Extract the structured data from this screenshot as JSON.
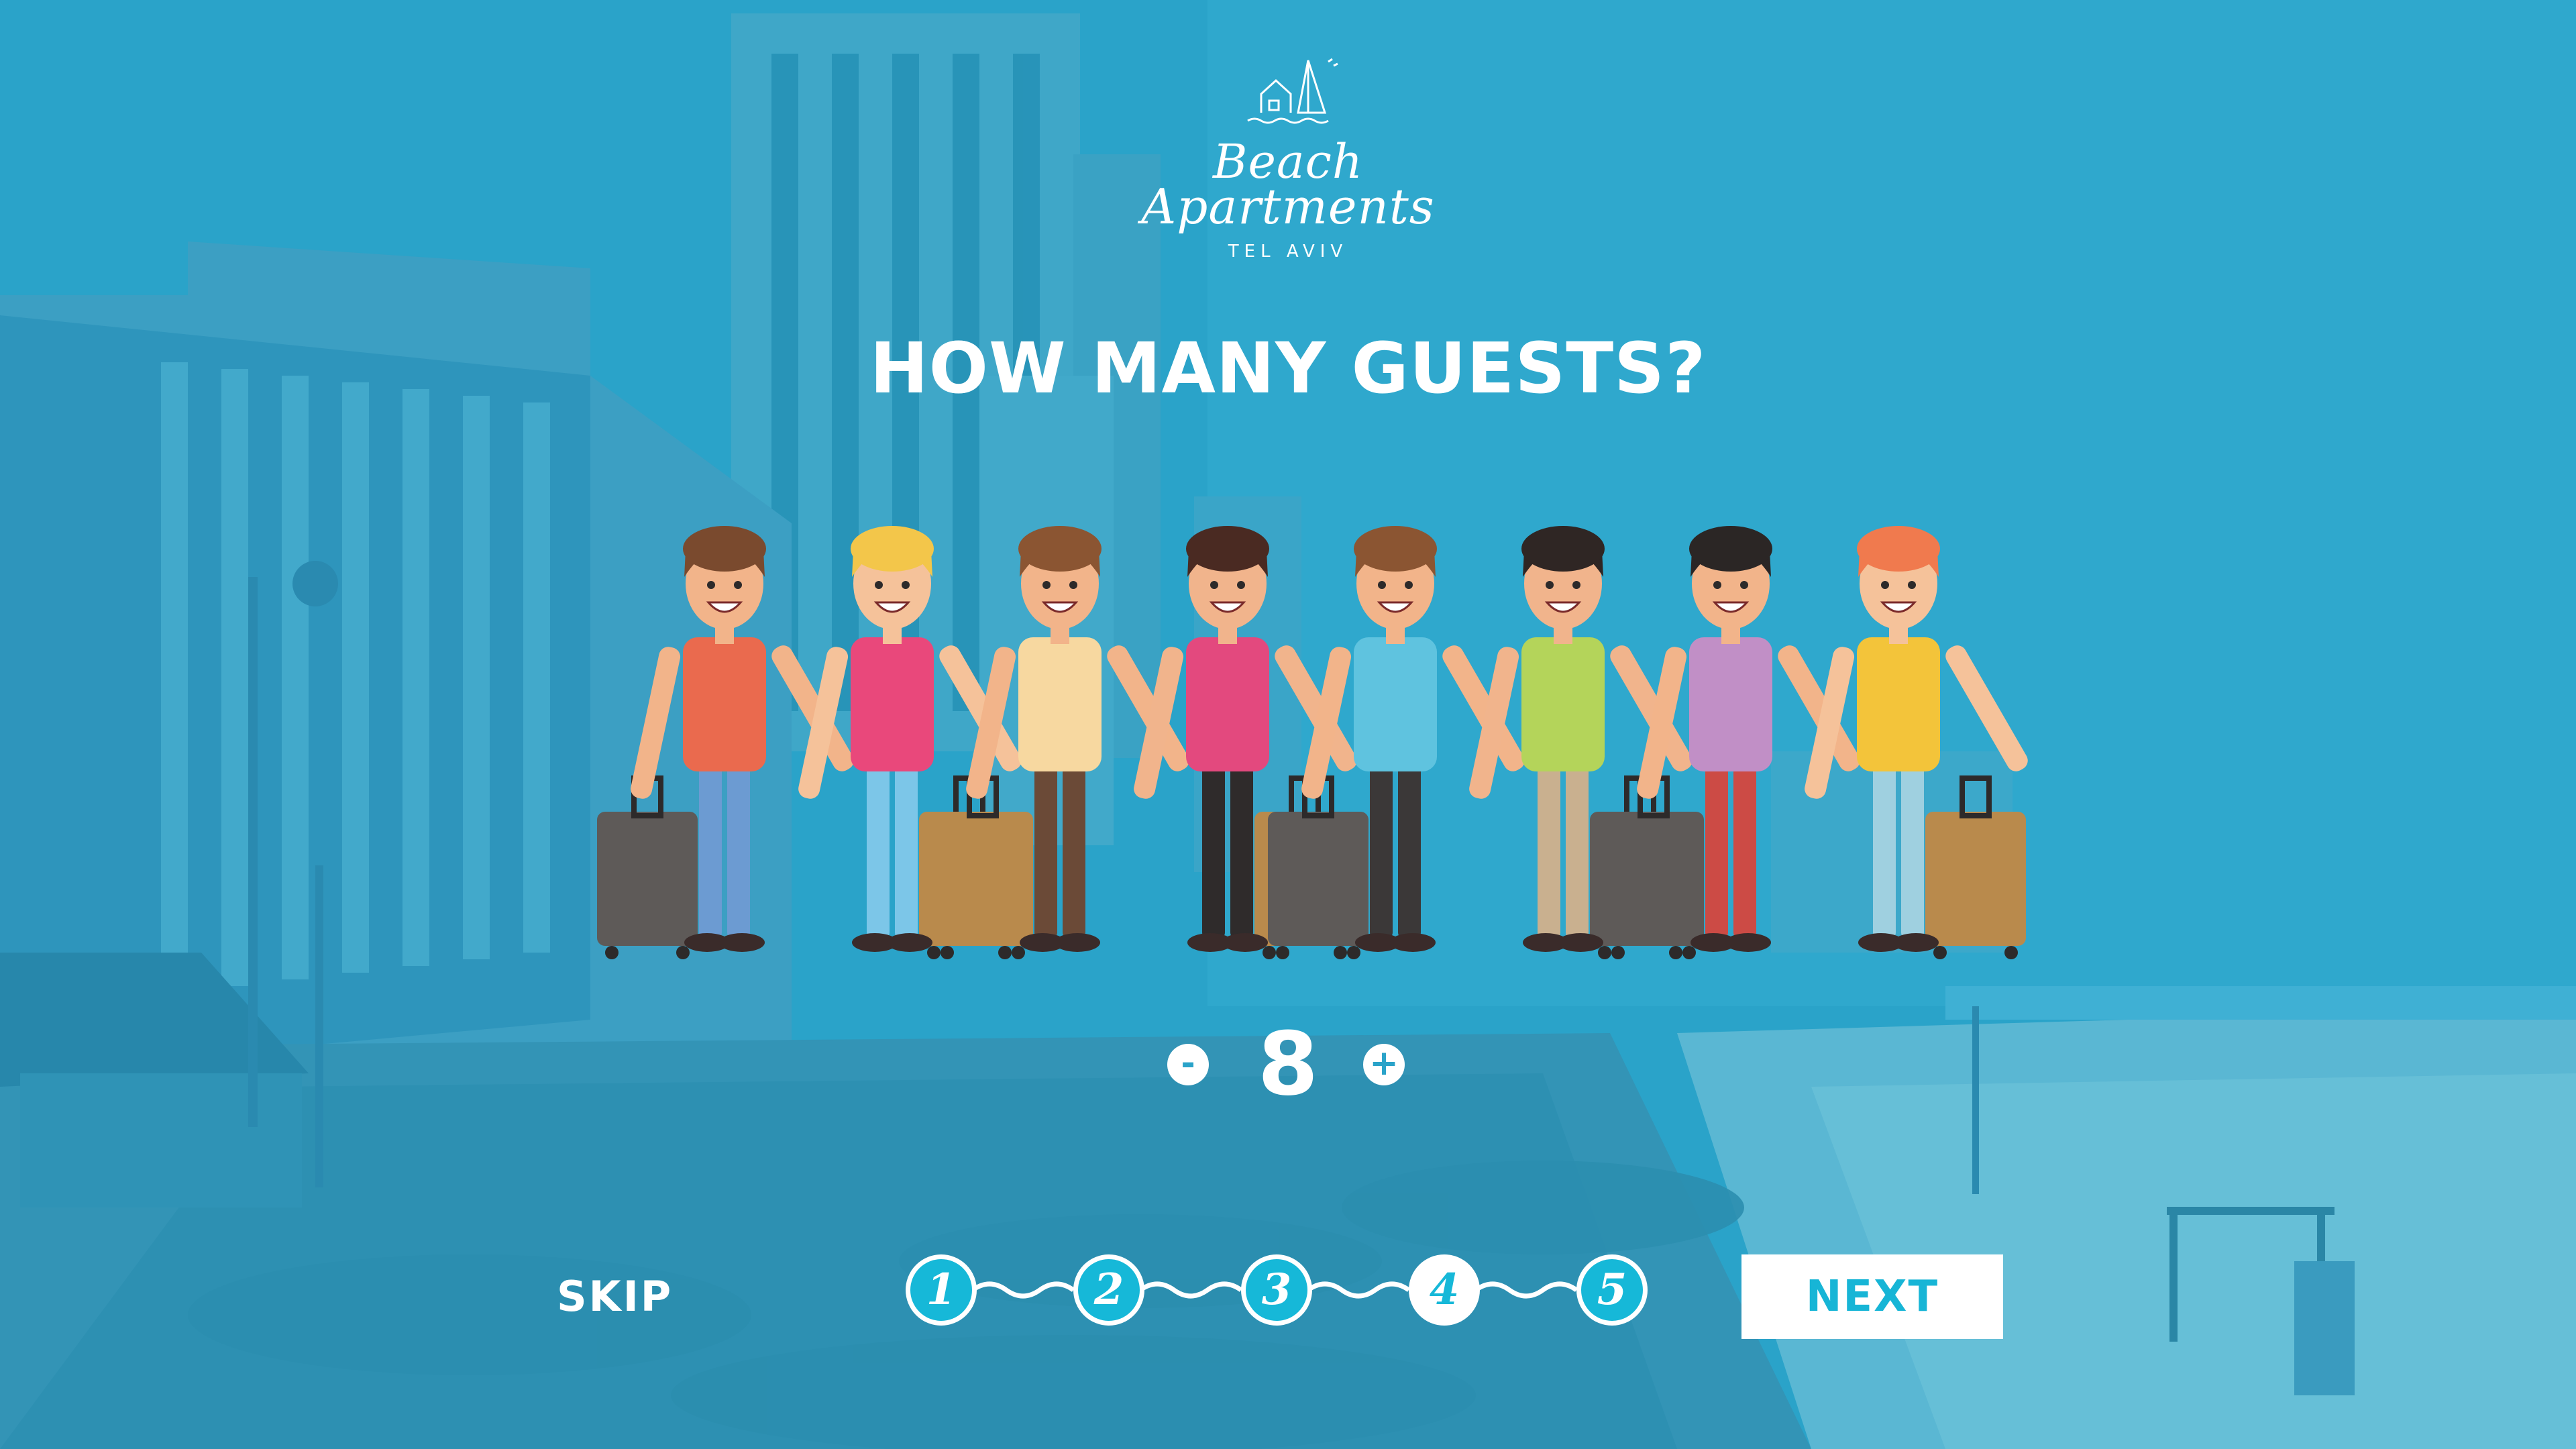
{
  "brand": {
    "line1": "Beach",
    "line2": "Apartments",
    "city": "TEL AVIV"
  },
  "title": "HOW MANY GUESTS?",
  "stepper": {
    "minus": "-",
    "plus": "+",
    "value": "8"
  },
  "skip_label": "SKIP",
  "next_label": "NEXT",
  "steps": [
    {
      "label": "1",
      "state": "done"
    },
    {
      "label": "2",
      "state": "done"
    },
    {
      "label": "3",
      "state": "done"
    },
    {
      "label": "4",
      "state": "active"
    },
    {
      "label": "5",
      "state": "todo"
    }
  ],
  "colors": {
    "overlay": "#2aa3c9",
    "accent": "#16b8d8",
    "white": "#ffffff"
  },
  "guests": [
    {
      "shirt": "#ea6a4e",
      "pants": "#6c9bd2",
      "hair": "#7a4a2e",
      "skin": "#f2b48a",
      "luggage": "#5e5a58"
    },
    {
      "shirt": "#e9487b",
      "pants": "#7cc6e8",
      "hair": "#f3c64a",
      "skin": "#f5c29a",
      "luggage": "#b98a4c"
    },
    {
      "shirt": "#f7d8a0",
      "pants": "#6b4a37",
      "hair": "#8b5532",
      "skin": "#f2b48a",
      "luggage": "#b98a4c"
    },
    {
      "shirt": "#e3497e",
      "pants": "#2f2b2b",
      "hair": "#4a2a22",
      "skin": "#f1b48c",
      "luggage": "#b98a4c"
    },
    {
      "shirt": "#5fc3df",
      "pants": "#3b3838",
      "hair": "#8b5532",
      "skin": "#f2b48a",
      "luggage": "#5e5a58"
    },
    {
      "shirt": "#b4d45a",
      "pants": "#c9b08f",
      "hair": "#2f2624",
      "skin": "#f1b48c",
      "luggage": "#5e5a58"
    },
    {
      "shirt": "#c18fc6",
      "pants": "#cc4b45",
      "hair": "#2b2625",
      "skin": "#f2b48a",
      "luggage": "#5e5a58"
    },
    {
      "shirt": "#f3c43a",
      "pants": "#9fd0e0",
      "hair": "#f07a4e",
      "skin": "#f5c29a",
      "luggage": "#b98a4c"
    }
  ]
}
